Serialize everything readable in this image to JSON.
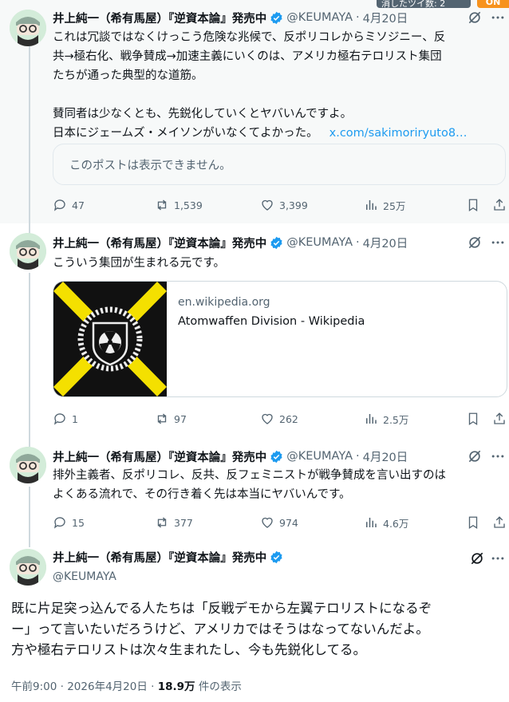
{
  "overlay": {
    "badge_text": "消したツイ数: 2",
    "toggle_label": "ON"
  },
  "author": {
    "name": "井上純一（希有馬屋）『逆資本論』発売中",
    "handle": "@KEUMAYA",
    "verified": true
  },
  "colors": {
    "accent": "#1d9bf0",
    "muted": "#536471",
    "text": "#0f1419",
    "verified": "#1d9bf0"
  },
  "icons": [
    "verified-badge-icon",
    "grok-icon",
    "more-icon",
    "reply-icon",
    "repost-icon",
    "like-icon",
    "views-icon",
    "bookmark-icon",
    "share-icon"
  ],
  "posts": [
    {
      "date": "4月20日",
      "text_lines": [
        "これは冗談ではなくけっこう危険な兆候で、反ポリコレからミソジニー、反",
        "共→極右化、戦争賛成→加速主義にいくのは、アメリカ極右テロリスト集団",
        "たちが通った典型的な道筋。",
        "",
        "賛同者は少なくとも、先鋭化していくとヤバいんですよ。",
        "日本にジェームズ・メイソンがいなくてよかった。"
      ],
      "link_text": "x.com/sakimoriryuto8…",
      "quote_unavailable": "このポストは表示できません。",
      "stats": {
        "replies": "47",
        "reposts": "1,539",
        "likes": "3,399",
        "views": "25万"
      }
    },
    {
      "date": "4月20日",
      "text_lines": [
        "こういう集団が生まれる元です。"
      ],
      "card": {
        "domain": "en.wikipedia.org",
        "title": "Atomwaffen Division - Wikipedia"
      },
      "stats": {
        "replies": "1",
        "reposts": "97",
        "likes": "262",
        "views": "2.5万"
      }
    },
    {
      "date": "4月20日",
      "text_lines": [
        "排外主義者、反ポリコレ、反共、反フェミニストが戦争賛成を言い出すのは",
        "よくある流れで、その行き着く先は本当にヤバいんです。"
      ],
      "stats": {
        "replies": "15",
        "reposts": "377",
        "likes": "974",
        "views": "4.6万"
      }
    }
  ],
  "main_post": {
    "text_lines": [
      "既に片足突っ込んでる人たちは「反戦デモから左翼テロリストになるぞ",
      "ー」って言いたいだろうけど、アメリカではそうはなってないんだよ。",
      "方や極右テロリストは次々生まれたし、今も先鋭化してる。"
    ],
    "time": "午前9:00",
    "date": "2026年4月20日",
    "views": "18.9万",
    "views_label": "件の表示"
  }
}
